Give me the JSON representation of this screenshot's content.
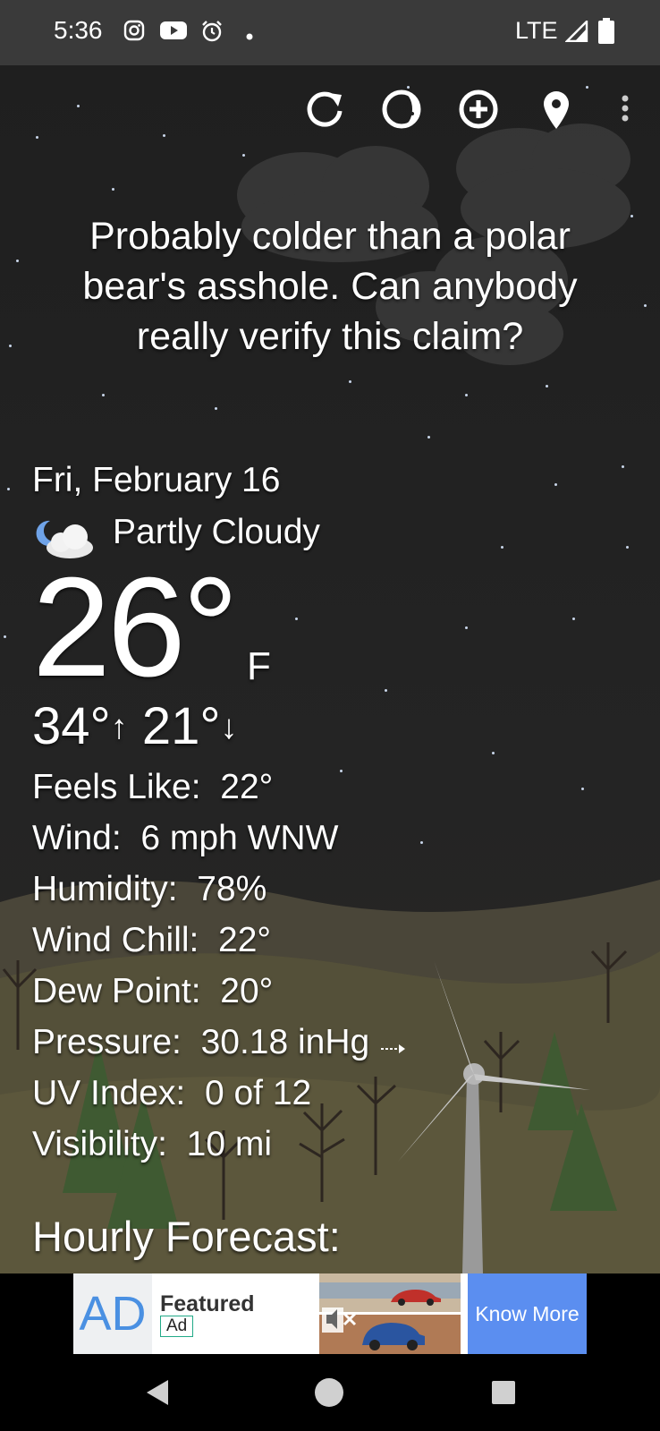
{
  "status_bar": {
    "time": "5:36",
    "network": "LTE",
    "icons": [
      "instagram-icon",
      "youtube-icon",
      "alarm-icon",
      "notification-dot-icon",
      "signal-icon",
      "battery-icon"
    ]
  },
  "toolbar": {
    "icons": [
      "refresh-icon",
      "moon-phase-icon",
      "add-location-icon",
      "location-pin-icon",
      "more-options-icon"
    ]
  },
  "joke_text": "Probably colder than a polar bear's asshole. Can anybody really verify this claim?",
  "weather": {
    "date": "Fri, February 16",
    "condition": "Partly Cloudy",
    "condition_icon": "partly-cloudy-night-icon",
    "temperature": "26°",
    "unit": "F",
    "high": "34°",
    "low": "21°",
    "high_arrow": "↑",
    "low_arrow": "↓"
  },
  "details": [
    {
      "label": "Feels Like:",
      "value": "22°"
    },
    {
      "label": "Wind:",
      "value": "6 mph WNW"
    },
    {
      "label": "Humidity:",
      "value": "78%"
    },
    {
      "label": "Wind Chill:",
      "value": "22°"
    },
    {
      "label": "Dew Point:",
      "value": "20°"
    },
    {
      "label": "Pressure:",
      "value": "30.18 inHg",
      "trend_icon": "pressure-steady-arrow-icon"
    },
    {
      "label": "UV Index:",
      "value": "0 of 12"
    },
    {
      "label": "Visibility:",
      "value": "10 mi"
    }
  ],
  "hourly_title": "Hourly Forecast:",
  "ad": {
    "logo": "AD",
    "featured": "Featured",
    "tag": "Ad",
    "cta": "Know More"
  },
  "colors": {
    "sky": "#1f1f1f",
    "status_bar": "#3a3a3a",
    "ad_cta": "#5b8ef0",
    "text": "#ffffff"
  }
}
